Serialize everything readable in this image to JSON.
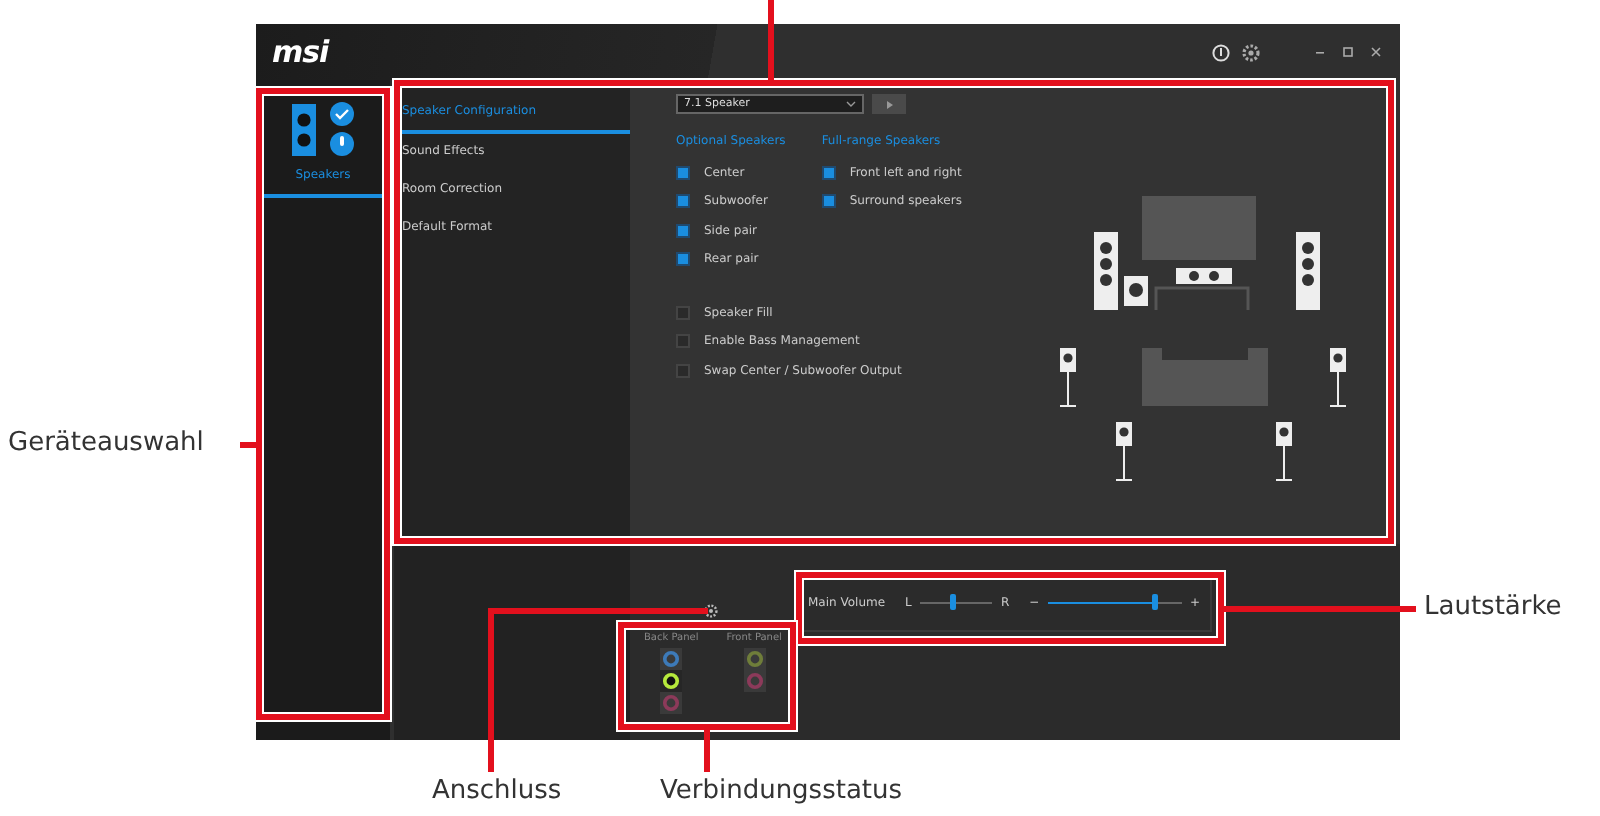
{
  "app": {
    "logo": "msi",
    "devices": [
      {
        "label": "Speakers",
        "selected": true
      }
    ],
    "tabs": [
      {
        "label": "Speaker Configuration",
        "selected": true
      },
      {
        "label": "Sound Effects",
        "selected": false
      },
      {
        "label": "Room Correction",
        "selected": false
      },
      {
        "label": "Default Format",
        "selected": false
      }
    ],
    "speaker_select": {
      "value": "7.1 Speaker"
    },
    "optional_speakers": {
      "heading": "Optional Speakers",
      "items": [
        {
          "label": "Center",
          "checked": true
        },
        {
          "label": "Subwoofer",
          "checked": true
        },
        {
          "label": "Side pair",
          "checked": true
        },
        {
          "label": "Rear pair",
          "checked": true
        }
      ]
    },
    "full_range_speakers": {
      "heading": "Full-range Speakers",
      "items": [
        {
          "label": "Front left and right",
          "checked": true
        },
        {
          "label": "Surround speakers",
          "checked": true
        }
      ]
    },
    "options": [
      {
        "label": "Speaker Fill",
        "checked": false
      },
      {
        "label": "Enable Bass Management",
        "checked": false
      },
      {
        "label": "Swap Center / Subwoofer Output",
        "checked": false
      }
    ],
    "jacks": {
      "back_panel_label": "Back Panel",
      "front_panel_label": "Front Panel",
      "back": [
        {
          "color": "#3d7ab8",
          "connected": false
        },
        {
          "color": "#b5e83c",
          "connected": true
        },
        {
          "color": "#8c3a5a",
          "connected": false
        }
      ],
      "front": [
        {
          "color": "#6f7d3a",
          "connected": false
        },
        {
          "color": "#8c3a5a",
          "connected": false
        }
      ]
    },
    "volume": {
      "label": "Main Volume",
      "balance_left": "L",
      "balance_right": "R",
      "balance": {
        "level": 0.45
      },
      "minus": "−",
      "plus": "+",
      "main": {
        "level": 0.8
      }
    }
  },
  "annotations": [
    {
      "label": "Geräteauswahl"
    },
    {
      "label": "Lautstärke"
    },
    {
      "label": "Anschluss"
    },
    {
      "label": "Verbindungsstatus"
    }
  ]
}
